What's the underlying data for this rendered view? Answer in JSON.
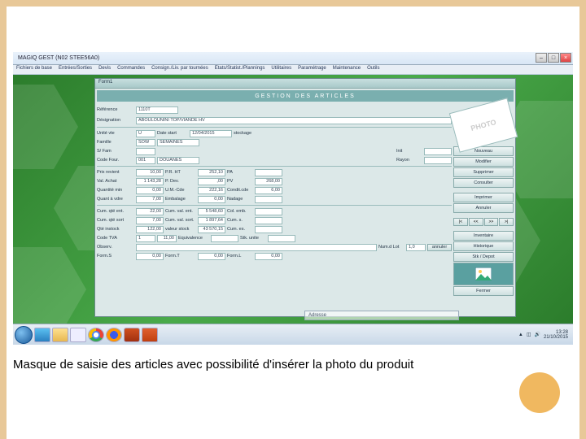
{
  "slide": {
    "caption": "Masque de saisie des articles avec possibilité d'insérer la photo du produit"
  },
  "app": {
    "title": "MAGIQ GEST (N02 STEE56A0)",
    "menus": [
      "Fichiers de base",
      "Entrées/Sorties",
      "Devis",
      "Commandes",
      "Consign./Liv. par tournées",
      "Etats/Statist./Plannings",
      "Utilitaires",
      "Paramétrage",
      "Maintenance",
      "Outils"
    ],
    "inner_title": "Form1",
    "header": "GESTION DES ARTICLES",
    "photo_placeholder": "PHOTO",
    "fields": {
      "reference_label": "Référence",
      "reference_value": "1110T",
      "designation_label": "Désignation",
      "designation_value": "ABOULOUNINI TOP/VIANDE HV",
      "unite_label": "Unité vte",
      "unite_value": "U",
      "date_start_label": "Date start",
      "date_start_value": "12/04/2015",
      "stockage_label": "stockage",
      "famille_label": "Famille",
      "famille_value": "SOW",
      "famille_desc": "SEMAINES",
      "sfam_label": "S/ Fam",
      "sfam_value": "",
      "codefour_label": "Code Four.",
      "codefour_value": "001",
      "codefour_desc": "DOUANES",
      "init_label": "Init",
      "rayon_label": "Rayon",
      "prix_rev_label": "Prix revient",
      "prix_rev_value": "10,00",
      "pr_ht_label": "P.R. HT",
      "pr_ht_value": "252,10",
      "pa_label": "PA",
      "pa_value": "",
      "val_achat_label": "Val. Achat",
      "val_achat_value": "1 143,28",
      "pxdev_label": "P. Dev.",
      "pxdev_value": ",00",
      "pv_label": "PV",
      "pv_value": "268,00",
      "qte_min_label": "Quantité min",
      "qte_min_value": "0,00",
      "umo_label": "U.M.-Cde",
      "umo_value": "222,16",
      "cond_label": "Condit.cde",
      "cond_value": "6,00",
      "qte_vte_label": "Quant à vdre",
      "qte_vte_value": "7,00",
      "embal_label": "Embalage",
      "embal_value": "0,00",
      "nadage_label": "Nadage",
      "cum_q_ent_label": "Cum. qté ent.",
      "cum_q_ent_value": "22,00",
      "cum_val_ent_label": "Cum. val. ent.",
      "cum_val_ent_value": "5 548,60",
      "col_emb_label": "Col. emb.",
      "cum_q_sort_label": "Cum. qté sort",
      "cum_q_sort_value": "7,00",
      "cum_val_sort_label": "Cum. val. sort.",
      "cum_val_sort_value": "1 897,64",
      "cum_s_label": "Cum. s.",
      "qte_instock_label": "Qté instock",
      "qte_instock_value": "122,00",
      "val_stock_label": "valeur stock",
      "val_stock_value": "43 570,15",
      "cum_es_label": "Cum. es.",
      "code_tva_label": "Code TVA",
      "code_tva_value": "1",
      "code_tva_pct": "11,00",
      "equiv_label": "Equivalence",
      "stk_unite_label": "Stk. unite",
      "observ_label": "Observ.",
      "num_lot_label": "Num.d Lot",
      "num_lot_value": "1,0",
      "num_lot_btn": "annuler",
      "form_s_label": "Form.S",
      "form_s_value": "0,00",
      "form_t_label": "Form.T",
      "form_t_value": "0,00",
      "form_l_label": "Form.L",
      "form_l_value": "0,00"
    },
    "side_buttons": {
      "nouveau": "Nouveau",
      "modifier": "Modifier",
      "supprimer": "Supprimer",
      "consulter": "Consulter",
      "imprimer": "Imprimer",
      "annuler": "Annuler",
      "inventaire": "Inventaire",
      "historique": "Historique",
      "stk_depot": "Stk / Depot",
      "fermer": "Fermer"
    },
    "address_label": "Adresse",
    "tray": {
      "time": "13:28",
      "date": "21/10/2015"
    }
  }
}
